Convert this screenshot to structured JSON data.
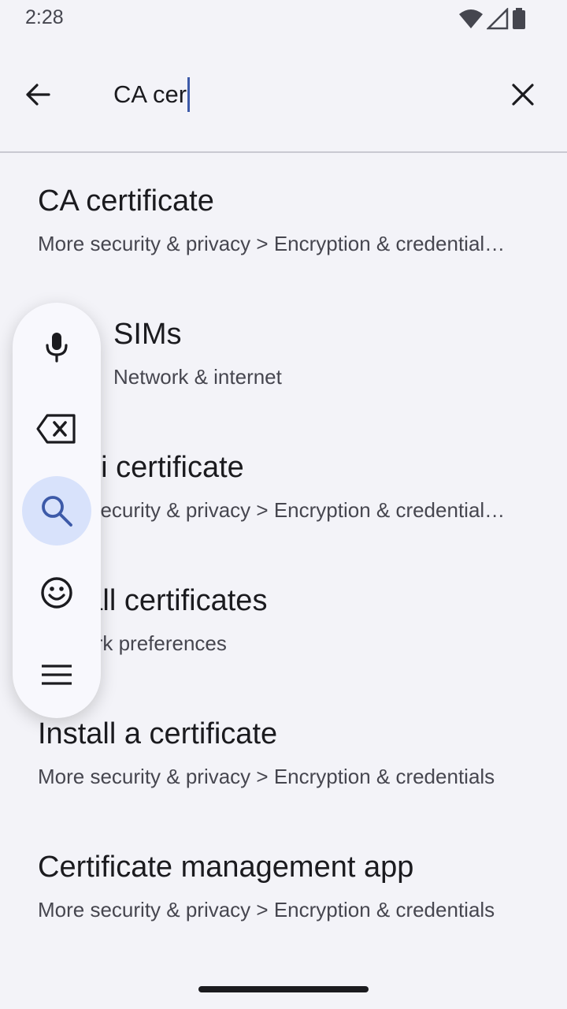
{
  "status_bar": {
    "time": "2:28",
    "icons": [
      "wifi-icon",
      "signal-icon",
      "battery-icon"
    ]
  },
  "search": {
    "query": "CA cer",
    "back_icon": "arrow-back-icon",
    "clear_icon": "close-icon"
  },
  "results": [
    {
      "title": "CA certificate",
      "subtitle": "More security & privacy > Encryption & credential…"
    },
    {
      "title": "SIMs",
      "subtitle": "Network & internet"
    },
    {
      "title": "Wi‑Fi certificate",
      "subtitle": "More security & privacy > Encryption & credential…"
    },
    {
      "title": "Install certificates",
      "subtitle": "Network preferences"
    },
    {
      "title": "Install a certificate",
      "subtitle": "More security & privacy > Encryption & credentials"
    },
    {
      "title": "Certificate management app",
      "subtitle": "More security & privacy > Encryption & credentials"
    }
  ],
  "keyboard_toolbar": {
    "buttons": [
      "mic-icon",
      "backspace-icon",
      "search-icon",
      "emoji-icon",
      "menu-icon"
    ],
    "active": "search-icon"
  },
  "colors": {
    "background": "#f3f3f8",
    "accent": "#3d5aa8",
    "active_button": "#d8e2fb"
  }
}
